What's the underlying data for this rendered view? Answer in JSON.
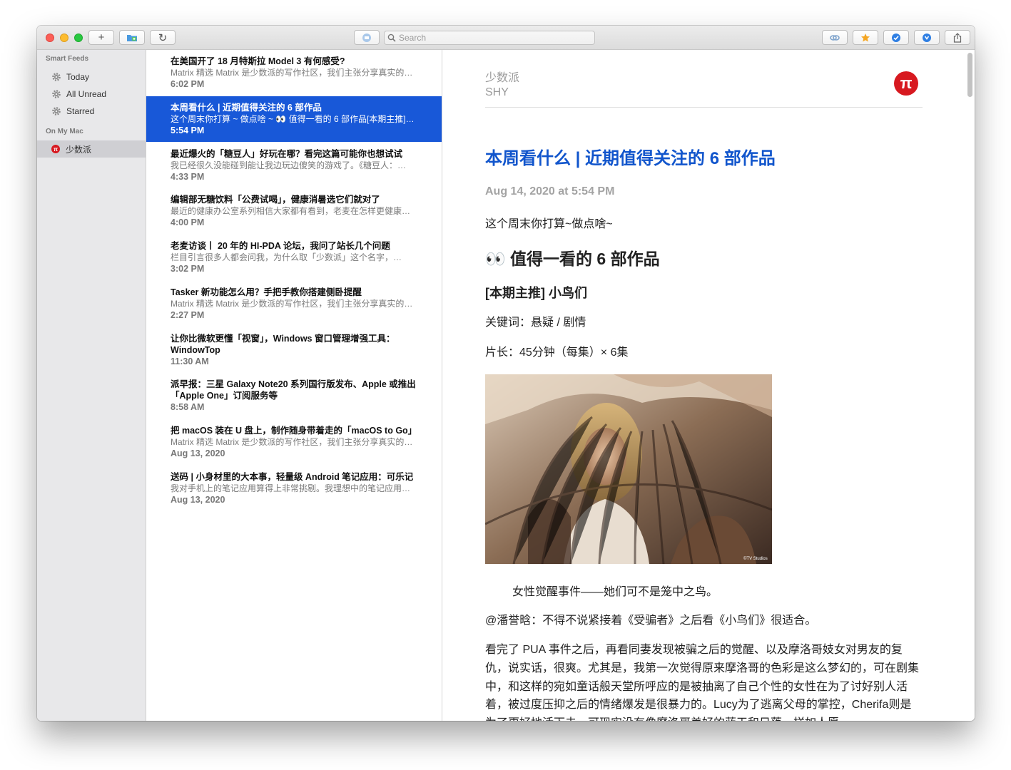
{
  "toolbar": {
    "search_placeholder": "Search",
    "add_label": "+",
    "refresh_label": "↻"
  },
  "sidebar": {
    "smart_feeds_header": "Smart Feeds",
    "smart_feeds": [
      {
        "label": "Today"
      },
      {
        "label": "All Unread"
      },
      {
        "label": "Starred"
      }
    ],
    "on_my_mac_header": "On My Mac",
    "feeds": [
      {
        "label": "少数派",
        "icon_letter": "π",
        "selected": true
      }
    ]
  },
  "articles": [
    {
      "title": "在美国开了 18 月特斯拉 Model 3 有何感受?",
      "summary": "Matrix 精选 Matrix 是少数派的写作社区，我们主张分享真实的…",
      "date": "6:02 PM"
    },
    {
      "title": "本周看什么 | 近期值得关注的 6 部作品",
      "summary": "这个周末你打算 ~ 做点啥 ~ 👀 值得一看的 6 部作品[本期主推]…",
      "date": "5:54 PM",
      "selected": true
    },
    {
      "title": "最近爆火的「糖豆人」好玩在哪？看完这篇可能你也想试试",
      "summary": "我已经很久没能碰到能让我边玩边傻笑的游戏了。《糖豆人：…",
      "date": "4:33 PM"
    },
    {
      "title": "编辑部无糖饮料「公费试喝」，健康消暑选它们就对了",
      "summary": "最近的健康办公室系列相信大家都有看到，老麦在怎样更健康…",
      "date": "4:00 PM"
    },
    {
      "title": "老麦访谈丨 20 年的 HI-PDA 论坛，我问了站长几个问题",
      "summary": "栏目引言很多人都会问我，为什么取「少数派」这个名字，…",
      "date": "3:02 PM"
    },
    {
      "title": "Tasker 新功能怎么用？手把手教你搭建侧卧提醒",
      "summary": "Matrix 精选 Matrix 是少数派的写作社区，我们主张分享真实的…",
      "date": "2:27 PM"
    },
    {
      "title": "让你比微软更懂「视窗」，Windows 窗口管理增强工具：WindowTop",
      "summary": "",
      "date": "11:30 AM",
      "wrap": true
    },
    {
      "title": "派早报：三星 Galaxy Note20 系列国行版发布、Apple 或推出「Apple One」订阅服务等",
      "summary": "",
      "date": "8:58 AM",
      "wrap": true
    },
    {
      "title": "把 macOS 装在 U 盘上，制作随身带着走的「macOS to Go」",
      "summary": "Matrix 精选 Matrix 是少数派的写作社区，我们主张分享真实的…",
      "date": "Aug 13, 2020"
    },
    {
      "title": "送码 | 小身材里的大本事，轻量级 Android 笔记应用：可乐记",
      "summary": "我对手机上的笔记应用算得上非常挑剔。我理想中的笔记应用…",
      "date": "Aug 13, 2020"
    }
  ],
  "article": {
    "feed_name": "少数派",
    "author": "SHY",
    "logo_letter": "π",
    "title": "本周看什么 | 近期值得关注的 6 部作品",
    "date": "Aug 14, 2020 at 5:54 PM",
    "intro": "这个周末你打算~做点啥~",
    "heading": "👀 值得一看的 6 部作品",
    "subheading": "[本期主推] 小鸟们",
    "keywords": "关键词：悬疑 / 剧情",
    "length": "片长：45分钟（每集）× 6集",
    "image_credit": "©TV Studios",
    "caption": "女性觉醒事件——她们可不是笼中之鸟。",
    "quote": "@潘誉晗：不得不说紧接着《受骗者》之后看《小鸟们》很适合。",
    "body": "看完了 PUA 事件之后，再看同妻发现被骗之后的觉醒、以及摩洛哥妓女对男友的复仇，说实话，很爽。尤其是，我第一次觉得原来摩洛哥的色彩是这么梦幻的，可在剧集中，和这样的宛如童话般天堂所呼应的是被抽离了自己个性的女性在为了讨好别人活着，被过度压抑之后的情绪爆发是很暴力的。Lucy为了逃离父母的掌控，Cherifa则是为了更好地活下去，可现实没有像摩洛哥美好的蓝天和日落一样如人愿。"
  }
}
